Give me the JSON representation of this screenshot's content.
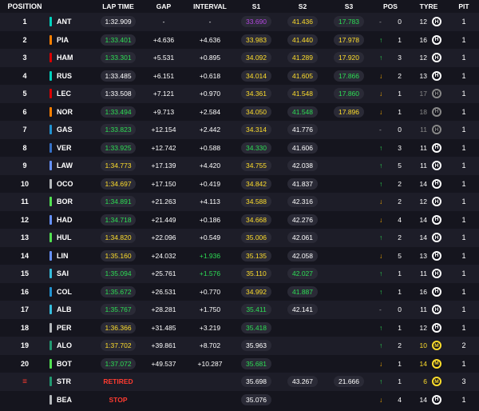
{
  "headers": {
    "position": "POSITION",
    "lap_time": "LAP TIME",
    "gap": "GAP",
    "interval": "INTERVAL",
    "s1": "S1",
    "s2": "S2",
    "s3": "S3",
    "pos": "POS",
    "tyre": "TYRE",
    "pit": "PIT"
  },
  "rows": [
    {
      "pos": "1",
      "drv": "ANT",
      "team": "#00d2be",
      "lap": "1:32.909",
      "lapc": "white",
      "gap": "-",
      "int": "-",
      "s1": "33.690",
      "s1c": "purple",
      "s2": "41.436",
      "s2c": "yellow",
      "s3": "17.783",
      "s3c": "green",
      "chg": "0",
      "chgd": "none",
      "tage": "12",
      "tc": "H",
      "tdim": false,
      "pit": "1"
    },
    {
      "pos": "2",
      "drv": "PIA",
      "team": "#ff8000",
      "lap": "1:33.401",
      "lapc": "green",
      "gap": "+4.636",
      "int": "+4.636",
      "s1": "33.983",
      "s1c": "yellow",
      "s2": "41.440",
      "s2c": "yellow",
      "s3": "17.978",
      "s3c": "yellow",
      "chg": "1",
      "chgd": "up",
      "tage": "16",
      "tc": "H",
      "tdim": false,
      "pit": "1"
    },
    {
      "pos": "3",
      "drv": "HAM",
      "team": "#dc0000",
      "lap": "1:33.301",
      "lapc": "green",
      "gap": "+5.531",
      "int": "+0.895",
      "s1": "34.092",
      "s1c": "yellow",
      "s2": "41.289",
      "s2c": "yellow",
      "s3": "17.920",
      "s3c": "yellow",
      "chg": "3",
      "chgd": "up",
      "tage": "12",
      "tc": "H",
      "tdim": false,
      "pit": "1"
    },
    {
      "pos": "4",
      "drv": "RUS",
      "team": "#00d2be",
      "lap": "1:33.485",
      "lapc": "white",
      "gap": "+6.151",
      "int": "+0.618",
      "s1": "34.014",
      "s1c": "yellow",
      "s2": "41.605",
      "s2c": "yellow",
      "s3": "17.866",
      "s3c": "green",
      "chg": "2",
      "chgd": "down",
      "tage": "13",
      "tc": "H",
      "tdim": false,
      "pit": "1"
    },
    {
      "pos": "5",
      "drv": "LEC",
      "team": "#dc0000",
      "lap": "1:33.508",
      "lapc": "white",
      "gap": "+7.121",
      "int": "+0.970",
      "s1": "34.361",
      "s1c": "yellow",
      "s2": "41.548",
      "s2c": "yellow",
      "s3": "17.860",
      "s3c": "green",
      "chg": "1",
      "chgd": "down",
      "tage": "17",
      "tc": "H",
      "tdim": true,
      "pit": "1"
    },
    {
      "pos": "6",
      "drv": "NOR",
      "team": "#ff8000",
      "lap": "1:33.494",
      "lapc": "green",
      "gap": "+9.713",
      "int": "+2.584",
      "s1": "34.050",
      "s1c": "yellow",
      "s2": "41.548",
      "s2c": "green",
      "s3": "17.896",
      "s3c": "yellow",
      "chg": "1",
      "chgd": "down",
      "tage": "18",
      "tc": "H",
      "tdim": true,
      "pit": "1"
    },
    {
      "pos": "7",
      "drv": "GAS",
      "team": "#2293d1",
      "lap": "1:33.823",
      "lapc": "green",
      "gap": "+12.154",
      "int": "+2.442",
      "s1": "34.314",
      "s1c": "yellow",
      "s2": "41.776",
      "s2c": "plain",
      "s3": "",
      "s3c": "",
      "chg": "0",
      "chgd": "none",
      "tage": "11",
      "tc": "H",
      "tdim": true,
      "pit": "1"
    },
    {
      "pos": "8",
      "drv": "VER",
      "team": "#3671c6",
      "lap": "1:33.925",
      "lapc": "green",
      "gap": "+12.742",
      "int": "+0.588",
      "s1": "34.330",
      "s1c": "green",
      "s2": "41.606",
      "s2c": "plain",
      "s3": "",
      "s3c": "",
      "chg": "3",
      "chgd": "up",
      "tage": "11",
      "tc": "H",
      "tdim": false,
      "pit": "1"
    },
    {
      "pos": "9",
      "drv": "LAW",
      "team": "#6692ff",
      "lap": "1:34.773",
      "lapc": "yellow",
      "gap": "+17.139",
      "int": "+4.420",
      "s1": "34.755",
      "s1c": "yellow",
      "s2": "42.038",
      "s2c": "plain",
      "s3": "",
      "s3c": "",
      "chg": "5",
      "chgd": "up",
      "tage": "11",
      "tc": "H",
      "tdim": false,
      "pit": "1"
    },
    {
      "pos": "10",
      "drv": "OCO",
      "team": "#b6babd",
      "lap": "1:34.697",
      "lapc": "yellow",
      "gap": "+17.150",
      "int": "+0.419",
      "s1": "34.842",
      "s1c": "yellow",
      "s2": "41.837",
      "s2c": "plain",
      "s3": "",
      "s3c": "",
      "chg": "2",
      "chgd": "up",
      "tage": "14",
      "tc": "H",
      "tdim": false,
      "pit": "1"
    },
    {
      "pos": "11",
      "drv": "BOR",
      "team": "#52e252",
      "lap": "1:34.891",
      "lapc": "green",
      "gap": "+21.263",
      "int": "+4.113",
      "s1": "34.588",
      "s1c": "yellow",
      "s2": "42.316",
      "s2c": "plain",
      "s3": "",
      "s3c": "",
      "chg": "2",
      "chgd": "down",
      "tage": "12",
      "tc": "H",
      "tdim": false,
      "pit": "1"
    },
    {
      "pos": "12",
      "drv": "HAD",
      "team": "#6692ff",
      "lap": "1:34.718",
      "lapc": "green",
      "gap": "+21.449",
      "int": "+0.186",
      "s1": "34.668",
      "s1c": "yellow",
      "s2": "42.276",
      "s2c": "plain",
      "s3": "",
      "s3c": "",
      "chg": "4",
      "chgd": "down",
      "tage": "14",
      "tc": "H",
      "tdim": false,
      "pit": "1"
    },
    {
      "pos": "13",
      "drv": "HUL",
      "team": "#52e252",
      "lap": "1:34.820",
      "lapc": "yellow",
      "gap": "+22.096",
      "int": "+0.549",
      "s1": "35.006",
      "s1c": "yellow",
      "s2": "42.061",
      "s2c": "plain",
      "s3": "",
      "s3c": "",
      "chg": "2",
      "chgd": "up",
      "tage": "14",
      "tc": "H",
      "tdim": false,
      "pit": "1"
    },
    {
      "pos": "14",
      "drv": "LIN",
      "team": "#6692ff",
      "lap": "1:35.160",
      "lapc": "yellow",
      "gap": "+24.032",
      "int": "+1.936",
      "intc": "green",
      "s1": "35.135",
      "s1c": "yellow",
      "s2": "42.058",
      "s2c": "plain",
      "s3": "",
      "s3c": "",
      "chg": "5",
      "chgd": "down",
      "tage": "13",
      "tc": "H",
      "tdim": false,
      "pit": "1"
    },
    {
      "pos": "15",
      "drv": "SAI",
      "team": "#37bedd",
      "lap": "1:35.094",
      "lapc": "green",
      "gap": "+25.761",
      "int": "+1.576",
      "intc": "green",
      "s1": "35.110",
      "s1c": "yellow",
      "s2": "42.027",
      "s2c": "green",
      "s3": "",
      "s3c": "",
      "chg": "1",
      "chgd": "up",
      "tage": "11",
      "tc": "H",
      "tdim": false,
      "pit": "1"
    },
    {
      "pos": "16",
      "drv": "COL",
      "team": "#2293d1",
      "lap": "1:35.672",
      "lapc": "green",
      "gap": "+26.531",
      "int": "+0.770",
      "s1": "34.992",
      "s1c": "yellow",
      "s2": "41.887",
      "s2c": "green",
      "s3": "",
      "s3c": "",
      "chg": "1",
      "chgd": "up",
      "tage": "16",
      "tc": "H",
      "tdim": false,
      "pit": "1"
    },
    {
      "pos": "17",
      "drv": "ALB",
      "team": "#37bedd",
      "lap": "1:35.767",
      "lapc": "green",
      "gap": "+28.281",
      "int": "+1.750",
      "s1": "35.411",
      "s1c": "green",
      "s2": "42.141",
      "s2c": "plain",
      "s3": "",
      "s3c": "",
      "chg": "0",
      "chgd": "none",
      "tage": "11",
      "tc": "H",
      "tdim": false,
      "pit": "1"
    },
    {
      "pos": "18",
      "drv": "PER",
      "team": "#b6babd",
      "lap": "1:36.366",
      "lapc": "yellow",
      "gap": "+31.485",
      "int": "+3.219",
      "s1": "35.418",
      "s1c": "green",
      "s2": "",
      "s2c": "",
      "s3": "",
      "s3c": "",
      "chg": "1",
      "chgd": "up",
      "tage": "12",
      "tc": "H",
      "tdim": false,
      "pit": "1"
    },
    {
      "pos": "19",
      "drv": "ALO",
      "team": "#229971",
      "lap": "1:37.702",
      "lapc": "yellow",
      "gap": "+39.861",
      "int": "+8.702",
      "s1": "35.963",
      "s1c": "plain",
      "s2": "",
      "s2c": "",
      "s3": "",
      "s3c": "",
      "chg": "2",
      "chgd": "up",
      "tage": "10",
      "tc": "M",
      "tdim": false,
      "pit": "2"
    },
    {
      "pos": "20",
      "drv": "BOT",
      "team": "#52e252",
      "lap": "1:37.072",
      "lapc": "green",
      "gap": "+49.537",
      "int": "+10.287",
      "s1": "35.681",
      "s1c": "green",
      "s2": "",
      "s2c": "",
      "s3": "",
      "s3c": "",
      "chg": "1",
      "chgd": "down",
      "tage": "14",
      "tc": "M",
      "tdim": false,
      "pit": "1"
    },
    {
      "pos": "≡",
      "drv": "STR",
      "team": "#229971",
      "lap": "",
      "lapc": "",
      "status": "RETIRED",
      "gap": "",
      "int": "",
      "s1": "35.698",
      "s1c": "plain",
      "s2": "43.267",
      "s2c": "plain",
      "s3": "21.666",
      "s3c": "plain",
      "chg": "1",
      "chgd": "up",
      "tage": "6",
      "tc": "M",
      "tdim": false,
      "pit": "3"
    },
    {
      "pos": "",
      "drv": "BEA",
      "team": "#b6babd",
      "lap": "",
      "lapc": "",
      "status": "STOP",
      "gap": "",
      "int": "",
      "s1": "35.076",
      "s1c": "plain",
      "s2": "",
      "s2c": "",
      "s3": "",
      "s3c": "",
      "chg": "4",
      "chgd": "down",
      "tage": "14",
      "tc": "H",
      "tdim": false,
      "pit": "1"
    }
  ]
}
